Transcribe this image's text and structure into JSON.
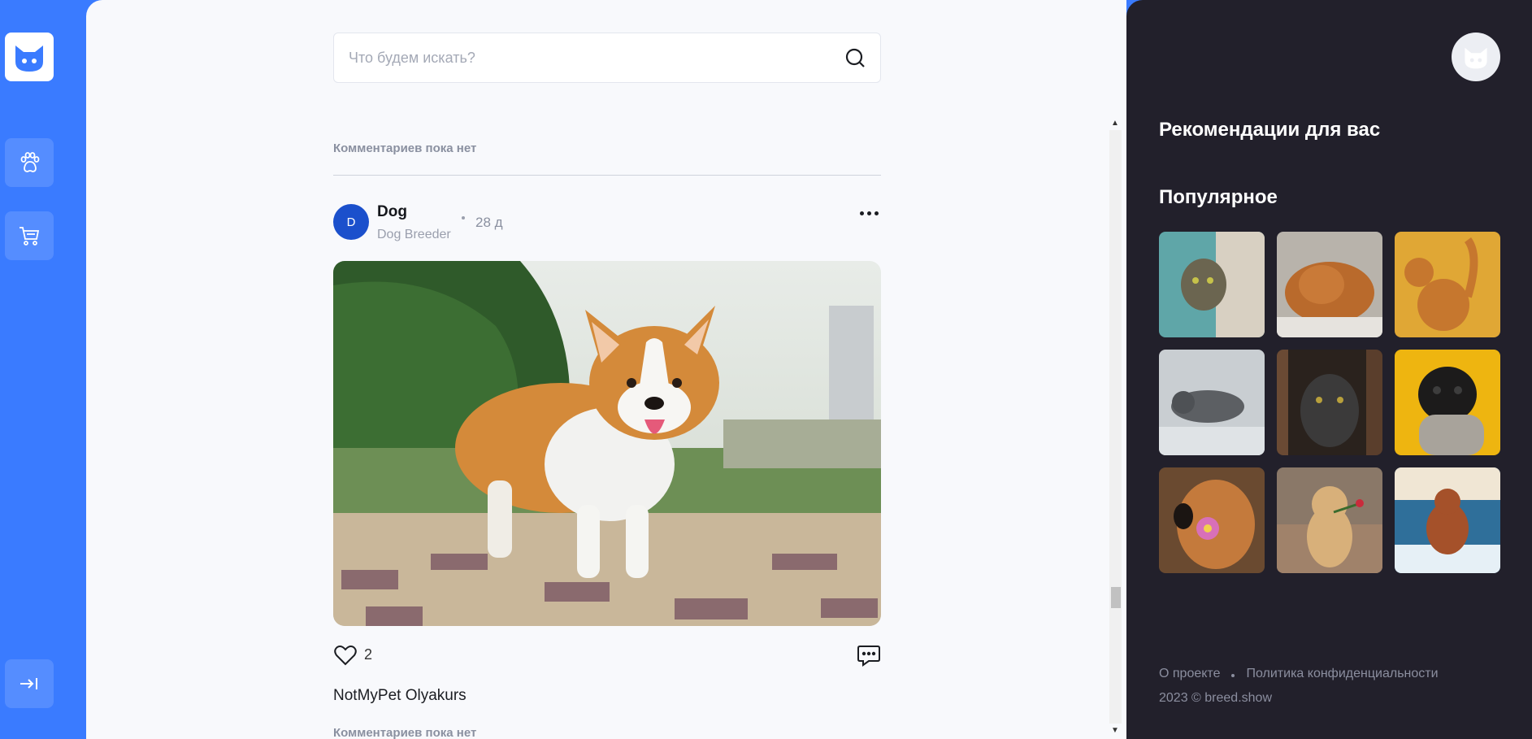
{
  "search": {
    "placeholder": "Что будем искать?",
    "icon": "search-icon"
  },
  "nav": {
    "items": [
      {
        "icon": "cat-logo-icon"
      },
      {
        "icon": "paw-icon"
      },
      {
        "icon": "cart-icon"
      },
      {
        "icon": "logout-icon"
      }
    ]
  },
  "feed": {
    "previous_post": {
      "no_comments": "Комментариев пока нет"
    },
    "post": {
      "avatar_letter": "D",
      "author": "Dog",
      "role": "Dog Breeder",
      "time": "28 д",
      "likes": "2",
      "caption": "NotMyPet Olyakurs",
      "no_comments": "Комментариев пока нет",
      "image": "corgi-photo"
    }
  },
  "sidebar": {
    "recommendations_title": "Рекомендации для вас",
    "popular_title": "Популярное",
    "popular": [
      {
        "image": "tabby-cat-peeking"
      },
      {
        "image": "orange-cat-sleeping"
      },
      {
        "image": "ginger-cat-yellow-bg"
      },
      {
        "image": "grey-cat-lying"
      },
      {
        "image": "black-cat-dark"
      },
      {
        "image": "pug-sweater-yellow"
      },
      {
        "image": "golden-retriever-flower"
      },
      {
        "image": "puppy-with-rose"
      },
      {
        "image": "dog-running-beach"
      }
    ],
    "footer": {
      "about": "О проекте",
      "privacy": "Политика конфиденциальности",
      "copyright": "2023 © breed.show"
    }
  },
  "colors": {
    "rail": "#3a7bff",
    "main_bg": "#f8f9fc",
    "right_bg": "#22202b",
    "avatar": "#1b50cc"
  }
}
